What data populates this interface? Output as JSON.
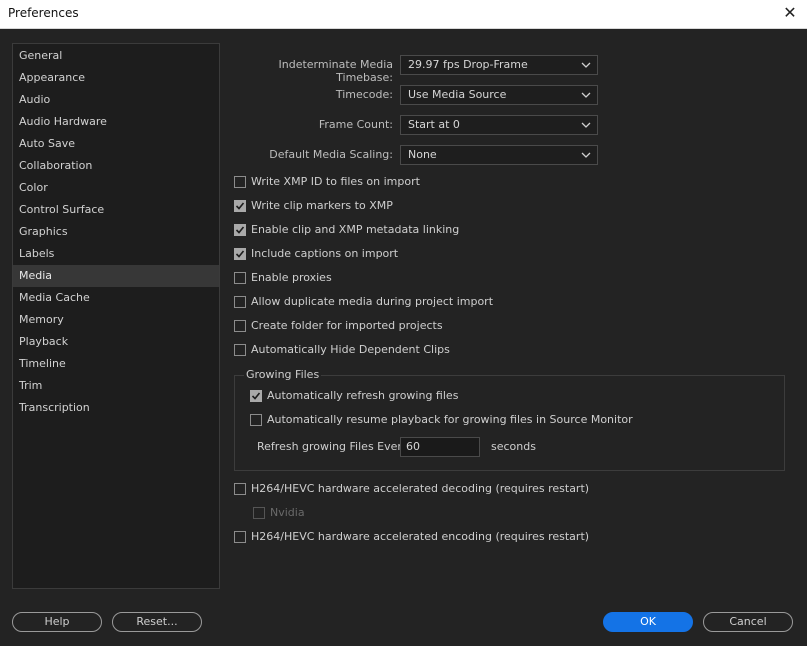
{
  "window": {
    "title": "Preferences",
    "close_glyph": "✕"
  },
  "sidebar": {
    "items": [
      {
        "label": "General"
      },
      {
        "label": "Appearance"
      },
      {
        "label": "Audio"
      },
      {
        "label": "Audio Hardware"
      },
      {
        "label": "Auto Save"
      },
      {
        "label": "Collaboration"
      },
      {
        "label": "Color"
      },
      {
        "label": "Control Surface"
      },
      {
        "label": "Graphics"
      },
      {
        "label": "Labels"
      },
      {
        "label": "Media",
        "selected": true
      },
      {
        "label": "Media Cache"
      },
      {
        "label": "Memory"
      },
      {
        "label": "Playback"
      },
      {
        "label": "Timeline"
      },
      {
        "label": "Trim"
      },
      {
        "label": "Transcription"
      }
    ]
  },
  "media": {
    "timebase": {
      "label": "Indeterminate Media Timebase:",
      "value": "29.97 fps Drop-Frame"
    },
    "timecode": {
      "label": "Timecode:",
      "value": "Use Media Source"
    },
    "frame_count": {
      "label": "Frame Count:",
      "value": "Start at 0"
    },
    "scaling": {
      "label": "Default Media Scaling:",
      "value": "None"
    },
    "checkboxes": [
      {
        "label": "Write XMP ID to files on import",
        "checked": false
      },
      {
        "label": "Write clip markers to XMP",
        "checked": true
      },
      {
        "label": "Enable clip and XMP metadata linking",
        "checked": true
      },
      {
        "label": "Include captions on import",
        "checked": true
      },
      {
        "label": "Enable proxies",
        "checked": false
      },
      {
        "label": "Allow duplicate media during project import",
        "checked": false
      },
      {
        "label": "Create folder for imported projects",
        "checked": false
      },
      {
        "label": "Automatically Hide Dependent Clips",
        "checked": false
      }
    ],
    "growing_files": {
      "title": "Growing Files",
      "auto_refresh": {
        "label": "Automatically refresh growing files",
        "checked": true
      },
      "auto_resume": {
        "label": "Automatically resume playback for growing files in Source Monitor",
        "checked": false
      },
      "refresh_label": "Refresh growing Files Every",
      "refresh_value": "60",
      "refresh_unit": "seconds"
    },
    "hw_decoding": {
      "label": "H264/HEVC hardware accelerated decoding (requires restart)",
      "checked": false
    },
    "nvidia": {
      "label": "Nvidia",
      "checked": false,
      "disabled": true
    },
    "hw_encoding": {
      "label": "H264/HEVC hardware accelerated encoding (requires restart)",
      "checked": false
    }
  },
  "buttons": {
    "help": "Help",
    "reset": "Reset...",
    "ok": "OK",
    "cancel": "Cancel"
  },
  "colors": {
    "accent": "#1473e6",
    "background": "#232323",
    "panel": "#1d1d1d",
    "selected": "#373737"
  }
}
